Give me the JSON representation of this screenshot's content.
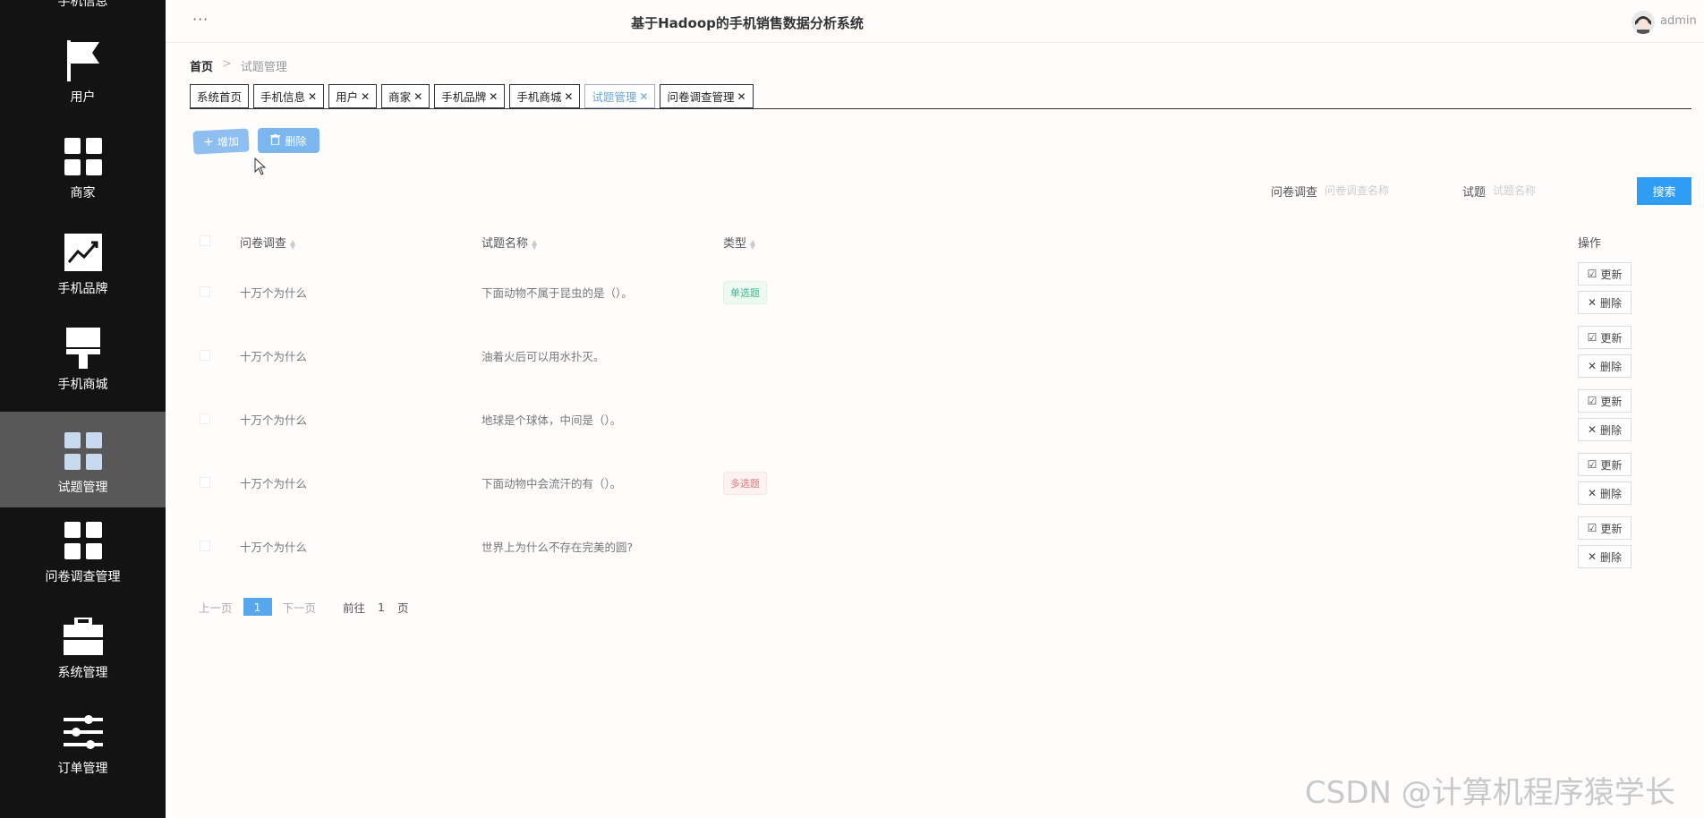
{
  "sidebar": {
    "top_partial_label": "手机信息",
    "items": [
      {
        "label": "用户",
        "icon": "flag-icon"
      },
      {
        "label": "商家",
        "icon": "grid-icon"
      },
      {
        "label": "手机品牌",
        "icon": "trend-chart-icon"
      },
      {
        "label": "手机商城",
        "icon": "brush-icon"
      },
      {
        "label": "试题管理",
        "icon": "grid-icon",
        "active": true
      },
      {
        "label": "问卷调查管理",
        "icon": "grid-icon"
      },
      {
        "label": "系统管理",
        "icon": "briefcase-icon"
      },
      {
        "label": "订单管理",
        "icon": "sliders-icon"
      }
    ]
  },
  "header": {
    "dots": "···",
    "title": "基于Hadoop的手机销售数据分析系统",
    "username": "admin"
  },
  "breadcrumb": {
    "home": "首页",
    "separator": ">",
    "current": "试题管理"
  },
  "tabs": [
    {
      "label": "系统首页",
      "closable": false
    },
    {
      "label": "手机信息",
      "closable": true
    },
    {
      "label": "用户",
      "closable": true
    },
    {
      "label": "商家",
      "closable": true
    },
    {
      "label": "手机品牌",
      "closable": true
    },
    {
      "label": "手机商城",
      "closable": true
    },
    {
      "label": "试题管理",
      "closable": true,
      "active": true
    },
    {
      "label": "问卷调查管理",
      "closable": true
    }
  ],
  "toolbar": {
    "add_label": "增加",
    "delete_label": "删除"
  },
  "search": {
    "survey_label": "问卷调查",
    "survey_placeholder": "问卷调查名称",
    "question_label": "试题",
    "question_placeholder": "试题名称",
    "button_label": "搜索"
  },
  "table": {
    "headers": {
      "survey": "问卷调查",
      "question": "试题名称",
      "type": "类型",
      "actions": "操作"
    },
    "rows": [
      {
        "survey": "十万个为什么",
        "question": "下面动物不属于昆虫的是（）。",
        "type": "单选题",
        "type_kind": "single"
      },
      {
        "survey": "十万个为什么",
        "question": "油着火后可以用水扑灭。",
        "type": "",
        "type_kind": ""
      },
      {
        "survey": "十万个为什么",
        "question": "地球是个球体，中间是（）。",
        "type": "",
        "type_kind": ""
      },
      {
        "survey": "十万个为什么",
        "question": "下面动物中会流汗的有（）。",
        "type": "多选题",
        "type_kind": "multi"
      },
      {
        "survey": "十万个为什么",
        "question": "世界上为什么不存在完美的圆?",
        "type": "",
        "type_kind": ""
      }
    ],
    "update_label": "更新",
    "delete_label": "删除"
  },
  "pagination": {
    "prev": "上一页",
    "current": "1",
    "next": "下一页",
    "goto": "前往",
    "goto_value": "1",
    "unit": "页"
  },
  "watermark": "CSDN @计算机程序猿学长",
  "colors": {
    "sidebar_bg": "#131313",
    "sidebar_active": "#585858",
    "primary": "#2f9cf6",
    "tag_single": "#3db88f",
    "tag_multi": "#e07878"
  }
}
